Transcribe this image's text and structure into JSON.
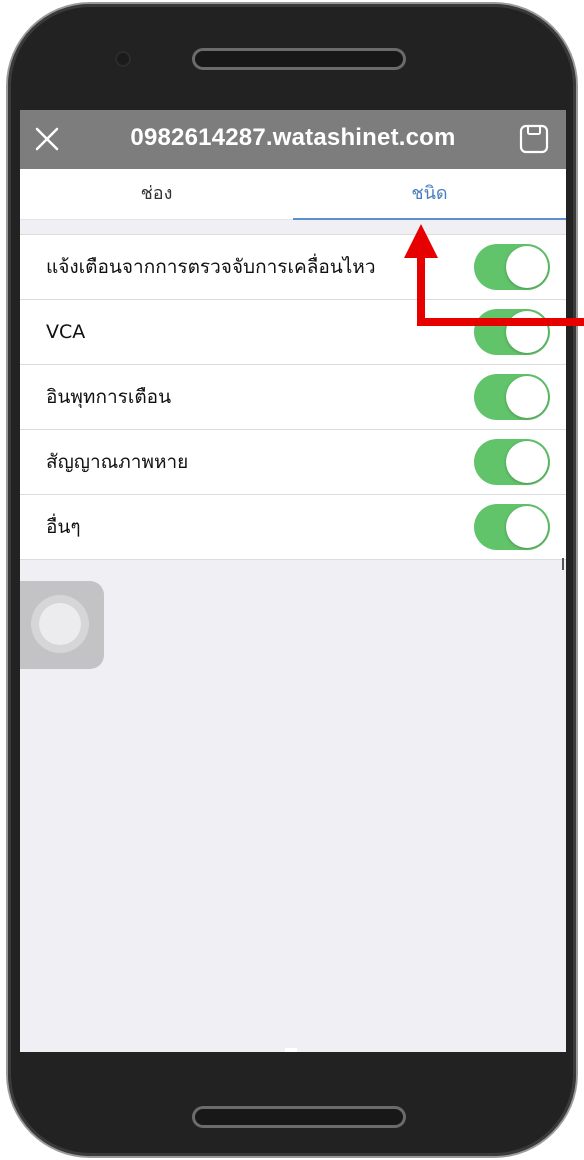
{
  "header": {
    "title": "0982614287.watashinet.com",
    "close_icon": "close-icon",
    "save_icon": "save-icon"
  },
  "tabs": [
    {
      "label": "ช่อง",
      "selected": false
    },
    {
      "label": "ชนิด",
      "selected": true
    }
  ],
  "settings": {
    "items": [
      {
        "label": "แจ้งเตือนจากการตรวจจับการเคลื่อนไหว",
        "enabled": true
      },
      {
        "label": "VCA",
        "enabled": true
      },
      {
        "label": "อินพุทการเตือน",
        "enabled": true
      },
      {
        "label": "สัญญาณภาพหาย",
        "enabled": true
      },
      {
        "label": "อื่นๆ",
        "enabled": true
      }
    ]
  },
  "colors": {
    "navbar": "#7d7d7d",
    "tab_accent": "#4a7ec2",
    "toggle_on": "#61c46a",
    "annotation_arrow": "#e60000"
  },
  "annotation": {
    "icon": "red-arrow-pointing-to-tab"
  }
}
